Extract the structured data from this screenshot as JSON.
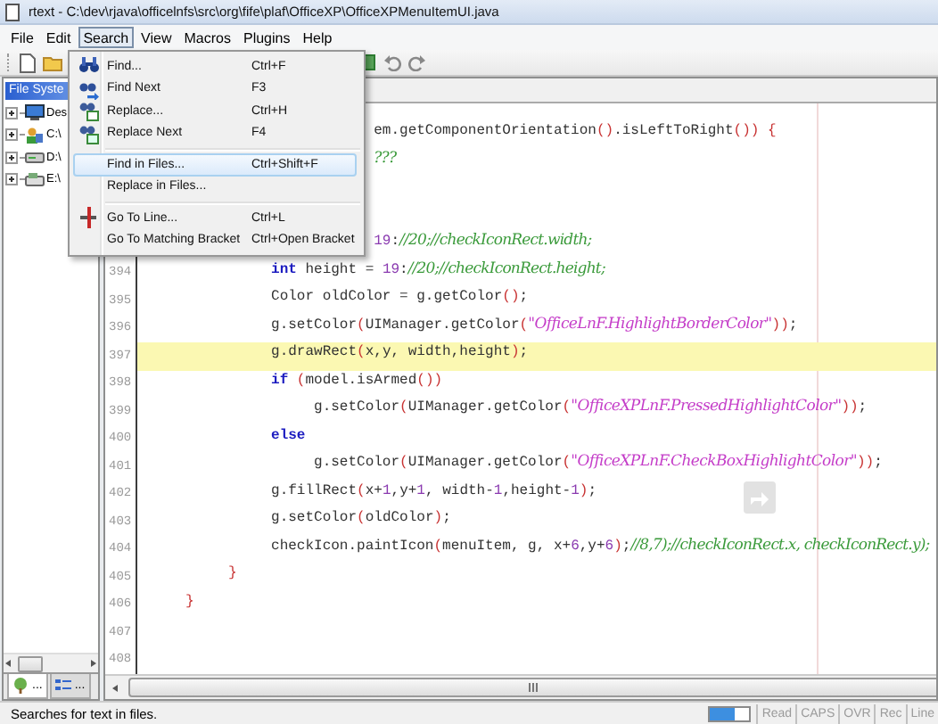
{
  "window": {
    "title": "rtext - C:\\dev\\rjava\\officelnfs\\src\\org\\fife\\plaf\\OfficeXP\\OfficeXPMenuItemUI.java"
  },
  "menu_bar": [
    {
      "label": "File",
      "selected": false
    },
    {
      "label": "Edit",
      "selected": false
    },
    {
      "label": "Search",
      "selected": true
    },
    {
      "label": "View",
      "selected": false
    },
    {
      "label": "Macros",
      "selected": false
    },
    {
      "label": "Plugins",
      "selected": false
    },
    {
      "label": "Help",
      "selected": false
    }
  ],
  "search_menu": {
    "items": [
      {
        "kind": "item",
        "label": "Find...",
        "shortcut": "Ctrl+F",
        "selected": false
      },
      {
        "kind": "item",
        "label": "Find Next",
        "shortcut": "F3",
        "selected": false
      },
      {
        "kind": "item",
        "label": "Replace...",
        "shortcut": "Ctrl+H",
        "selected": false
      },
      {
        "kind": "item",
        "label": "Replace Next",
        "shortcut": "F4",
        "selected": false
      },
      {
        "kind": "separator"
      },
      {
        "kind": "item",
        "label": "Find in Files...",
        "shortcut": "Ctrl+Shift+F",
        "selected": true
      },
      {
        "kind": "item",
        "label": "Replace in Files...",
        "selected": false
      },
      {
        "kind": "separator"
      },
      {
        "kind": "item",
        "label": "Go To Line...",
        "shortcut": "Ctrl+L",
        "selected": false
      },
      {
        "kind": "item",
        "label": "Go To Matching Bracket",
        "shortcut": "Ctrl+Open Bracket",
        "selected": false
      }
    ]
  },
  "file_system_panel": {
    "title": "File Syste",
    "tree": [
      {
        "label": "Des",
        "expanded": false
      },
      {
        "label": "C:\\",
        "expanded": false
      },
      {
        "label": "D:\\",
        "expanded": false
      },
      {
        "label": "E:\\",
        "expanded": false
      }
    ],
    "tabs": [
      {
        "label": "...",
        "selected": true
      },
      {
        "label": "...",
        "selected": false
      }
    ]
  },
  "editor": {
    "lines": [
      {
        "kind": "code",
        "highlighted": false,
        "tokens": [
          {
            "kind": "code",
            "text": "                           em.getComponentOrientation"
          },
          {
            "kind": "bracket",
            "text": "()"
          },
          {
            "kind": "code",
            "text": ".isLeftToRight"
          },
          {
            "kind": "bracket",
            "text": "())"
          },
          {
            "kind": "bracket",
            "text": " {"
          }
        ]
      },
      {
        "kind": "code",
        "highlighted": false,
        "tokens": [
          {
            "kind": "comment",
            "text": "                           ???"
          }
        ]
      },
      {
        "kind": "blank",
        "highlighted": false
      },
      {
        "kind": "blank",
        "highlighted": false
      },
      {
        "kind": "code",
        "highlighted": false,
        "tokens": [
          {
            "kind": "number",
            "text": "                           19"
          },
          {
            "kind": "code",
            "text": ":"
          },
          {
            "kind": "comment",
            "text": "//20;//checkIconRect.width;"
          }
        ]
      },
      {
        "kind": "code",
        "number": "394",
        "highlighted": false,
        "tokens": [
          {
            "kind": "keyword",
            "text": "               int"
          },
          {
            "kind": "code",
            "text": " height = "
          },
          {
            "kind": "number",
            "text": "19"
          },
          {
            "kind": "code",
            "text": ":"
          },
          {
            "kind": "comment",
            "text": "//20;//checkIconRect.height;"
          }
        ]
      },
      {
        "kind": "code",
        "number": "395",
        "highlighted": false,
        "tokens": [
          {
            "kind": "code",
            "text": "               Color oldColor = g.getColor"
          },
          {
            "kind": "bracket",
            "text": "()"
          },
          {
            "kind": "code",
            "text": ";"
          }
        ]
      },
      {
        "kind": "code",
        "number": "396",
        "highlighted": false,
        "tokens": [
          {
            "kind": "code",
            "text": "               g.setColor"
          },
          {
            "kind": "bracket",
            "text": "("
          },
          {
            "kind": "code",
            "text": "UIManager.getColor"
          },
          {
            "kind": "bracket",
            "text": "("
          },
          {
            "kind": "string",
            "text": "\"OfficeLnF.HighlightBorderColor\""
          },
          {
            "kind": "bracket",
            "text": "))"
          },
          {
            "kind": "code",
            "text": ";"
          }
        ]
      },
      {
        "kind": "code",
        "number": "397",
        "highlighted": true,
        "tokens": [
          {
            "kind": "code",
            "text": "               g.drawRect"
          },
          {
            "kind": "bracket",
            "text": "("
          },
          {
            "kind": "code",
            "text": "x,y, width,height"
          },
          {
            "kind": "bracket",
            "text": ")"
          },
          {
            "kind": "code",
            "text": ";"
          }
        ]
      },
      {
        "kind": "code",
        "number": "398",
        "highlighted": false,
        "tokens": [
          {
            "kind": "keyword",
            "text": "               if"
          },
          {
            "kind": "bracket",
            "text": " ("
          },
          {
            "kind": "code",
            "text": "model.isArmed"
          },
          {
            "kind": "bracket",
            "text": "())"
          }
        ]
      },
      {
        "kind": "code",
        "number": "399",
        "highlighted": false,
        "tokens": [
          {
            "kind": "code",
            "text": "                    g.setColor"
          },
          {
            "kind": "bracket",
            "text": "("
          },
          {
            "kind": "code",
            "text": "UIManager.getColor"
          },
          {
            "kind": "bracket",
            "text": "("
          },
          {
            "kind": "string",
            "text": "\"OfficeXPLnF.PressedHighlightColor\""
          },
          {
            "kind": "bracket",
            "text": "))"
          },
          {
            "kind": "code",
            "text": ";"
          }
        ]
      },
      {
        "kind": "code",
        "number": "400",
        "highlighted": false,
        "tokens": [
          {
            "kind": "keyword",
            "text": "               else"
          }
        ]
      },
      {
        "kind": "code",
        "number": "401",
        "highlighted": false,
        "tokens": [
          {
            "kind": "code",
            "text": "                    g.setColor"
          },
          {
            "kind": "bracket",
            "text": "("
          },
          {
            "kind": "code",
            "text": "UIManager.getColor"
          },
          {
            "kind": "bracket",
            "text": "("
          },
          {
            "kind": "string",
            "text": "\"OfficeXPLnF.CheckBoxHighlightColor\""
          },
          {
            "kind": "bracket",
            "text": "))"
          },
          {
            "kind": "code",
            "text": ";"
          }
        ]
      },
      {
        "kind": "code",
        "number": "402",
        "highlighted": false,
        "tokens": [
          {
            "kind": "code",
            "text": "               g.fillRect"
          },
          {
            "kind": "bracket",
            "text": "("
          },
          {
            "kind": "code",
            "text": "x+"
          },
          {
            "kind": "number",
            "text": "1"
          },
          {
            "kind": "code",
            "text": ",y+"
          },
          {
            "kind": "number",
            "text": "1"
          },
          {
            "kind": "code",
            "text": ", width-"
          },
          {
            "kind": "number",
            "text": "1"
          },
          {
            "kind": "code",
            "text": ",height-"
          },
          {
            "kind": "number",
            "text": "1"
          },
          {
            "kind": "bracket",
            "text": ")"
          },
          {
            "kind": "code",
            "text": ";"
          }
        ]
      },
      {
        "kind": "code",
        "number": "403",
        "highlighted": false,
        "tokens": [
          {
            "kind": "code",
            "text": "               g.setColor"
          },
          {
            "kind": "bracket",
            "text": "("
          },
          {
            "kind": "code",
            "text": "oldColor"
          },
          {
            "kind": "bracket",
            "text": ")"
          },
          {
            "kind": "code",
            "text": ";"
          }
        ]
      },
      {
        "kind": "code",
        "number": "404",
        "highlighted": false,
        "tokens": [
          {
            "kind": "code",
            "text": "               checkIcon.paintIcon"
          },
          {
            "kind": "bracket",
            "text": "("
          },
          {
            "kind": "code",
            "text": "menuItem, g, x+"
          },
          {
            "kind": "number",
            "text": "6"
          },
          {
            "kind": "code",
            "text": ",y+"
          },
          {
            "kind": "number",
            "text": "6"
          },
          {
            "kind": "bracket",
            "text": ")"
          },
          {
            "kind": "code",
            "text": ";"
          },
          {
            "kind": "comment",
            "text": "//8,7);//checkIconRect.x, checkIconRect.y);"
          }
        ]
      },
      {
        "kind": "code",
        "number": "405",
        "highlighted": false,
        "tokens": [
          {
            "kind": "bracket",
            "text": "          }"
          }
        ]
      },
      {
        "kind": "code",
        "number": "406",
        "highlighted": false,
        "tokens": [
          {
            "kind": "bracket",
            "text": "     }"
          }
        ]
      },
      {
        "kind": "code",
        "number": "407",
        "highlighted": false
      },
      {
        "kind": "code",
        "number": "408",
        "highlighted": false
      }
    ]
  },
  "status_bar": {
    "message": "Searches for text in files.",
    "meter": {
      "level": 0.6
    },
    "indicators": [
      "Read",
      "CAPS",
      "OVR",
      "Rec",
      "Line"
    ]
  }
}
